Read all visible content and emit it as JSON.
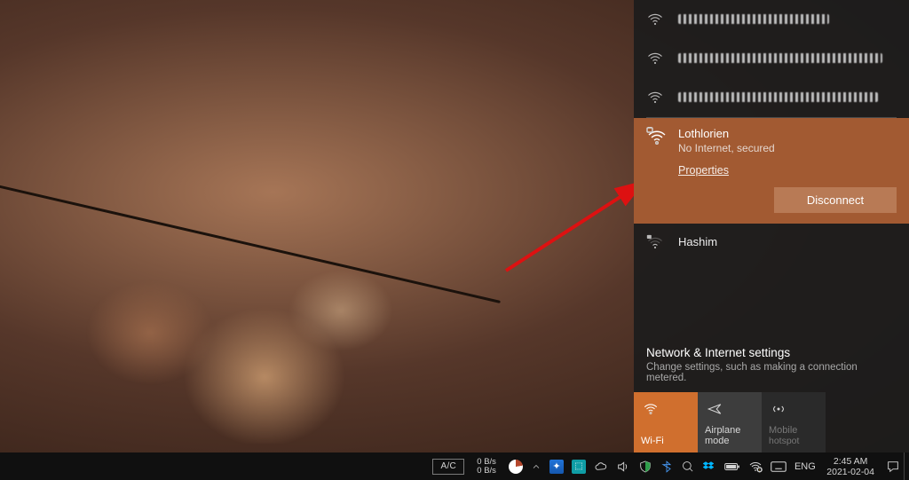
{
  "networks_obscured_count": 3,
  "selected_network": {
    "name": "Lothlorien",
    "status": "No Internet, secured",
    "properties_label": "Properties",
    "disconnect_label": "Disconnect"
  },
  "other_networks": [
    {
      "name": "Hashim"
    }
  ],
  "settings_link": {
    "title": "Network & Internet settings",
    "subtitle": "Change settings, such as making a connection metered."
  },
  "tiles": {
    "wifi": "Wi-Fi",
    "airplane": "Airplane mode",
    "hotspot_line1": "Mobile",
    "hotspot_line2": "hotspot"
  },
  "taskbar": {
    "kbd_mode": "A/C",
    "net_rate_up": "0 B/s",
    "net_rate_down": "0 B/s",
    "lang": "ENG",
    "time": "2:45 AM",
    "date": "2021-02-04"
  }
}
